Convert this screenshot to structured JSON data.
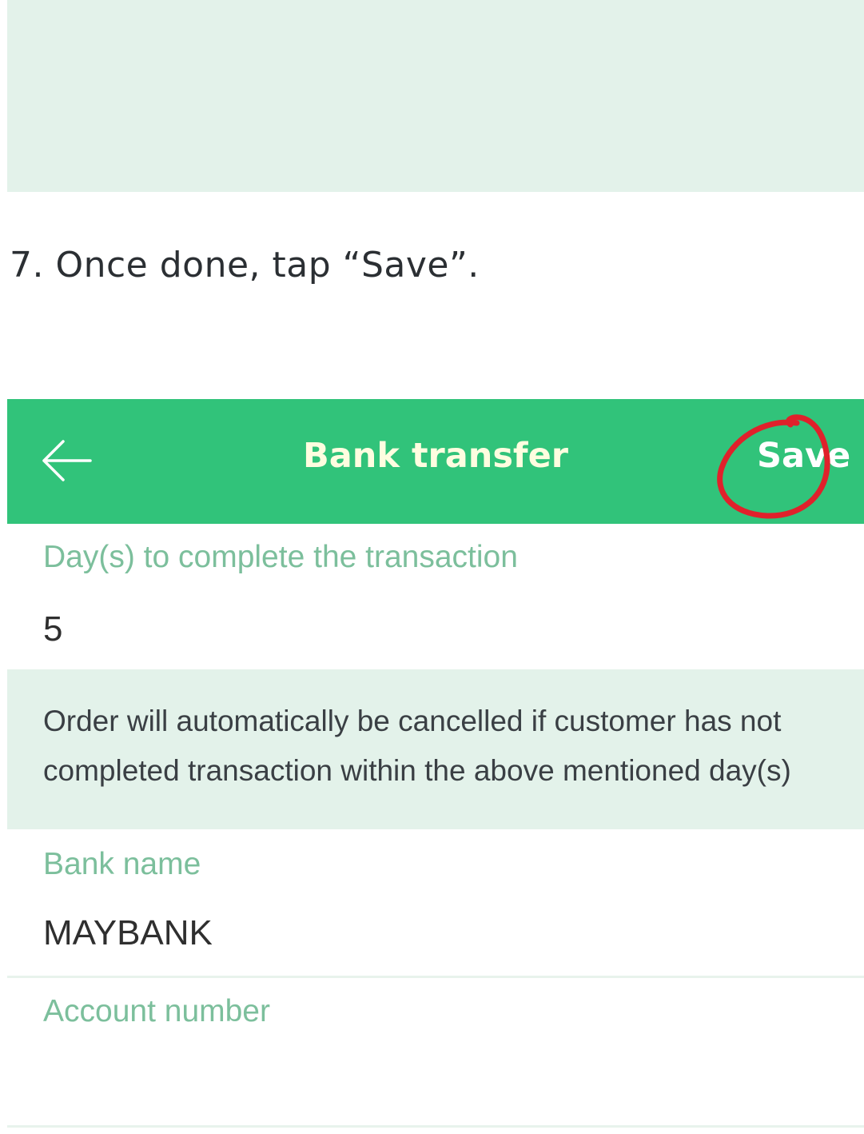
{
  "instruction": {
    "text": "7. Once done, tap “Save”."
  },
  "app_bar": {
    "title": "Bank transfer",
    "save_label": "Save",
    "back_icon": "arrow-left-icon",
    "background": "#31c37a",
    "highlight_color": "#e0212b"
  },
  "form": {
    "days": {
      "label": "Day(s) to complete the transaction",
      "value": "5"
    },
    "note": "Order will automatically be cancelled if customer has not completed transaction within the above mentioned day(s)",
    "bank_name": {
      "label": "Bank name",
      "value": "MAYBANK"
    },
    "account_number": {
      "label": "Account number",
      "value": ""
    }
  },
  "colors": {
    "label": "#7cbf9c",
    "panel": "#e3f2ea"
  }
}
